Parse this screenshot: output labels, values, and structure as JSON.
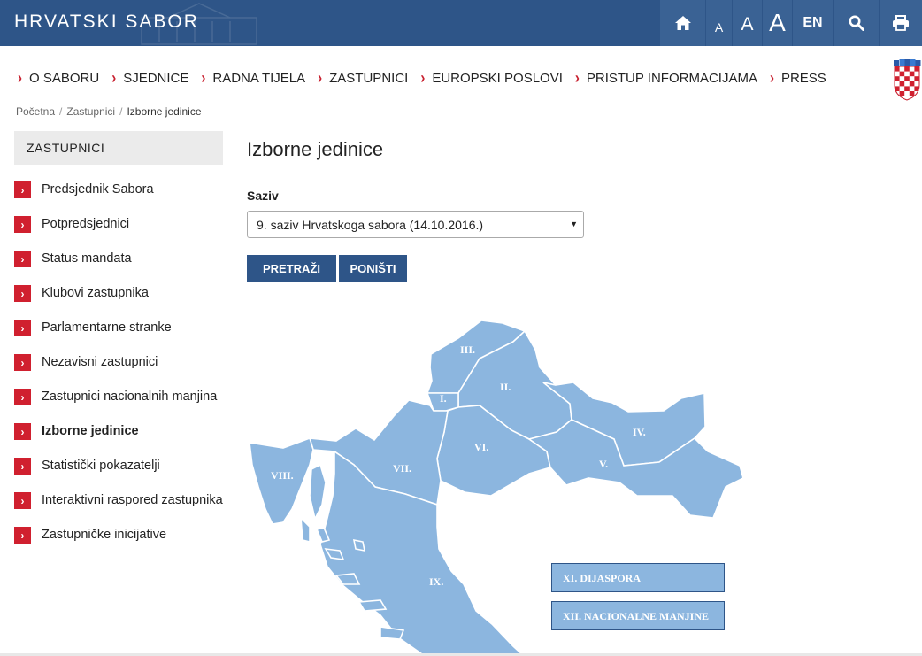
{
  "header": {
    "logo": "HRVATSKI SABOR",
    "font_small": "A",
    "font_medium": "A",
    "font_large": "A",
    "language": "EN"
  },
  "nav": [
    "O SABORU",
    "SJEDNICE",
    "RADNA TIJELA",
    "ZASTUPNICI",
    "EUROPSKI POSLOVI",
    "PRISTUP INFORMACIJAMA",
    "PRESS"
  ],
  "breadcrumb": [
    "Početna",
    "Zastupnici",
    "Izborne jedinice"
  ],
  "sidebar": {
    "title": "ZASTUPNICI",
    "items": [
      {
        "label": "Predsjednik Sabora"
      },
      {
        "label": "Potpredsjednici"
      },
      {
        "label": "Status mandata"
      },
      {
        "label": "Klubovi zastupnika"
      },
      {
        "label": "Parlamentarne stranke"
      },
      {
        "label": "Nezavisni zastupnici"
      },
      {
        "label": "Zastupnici nacionalnih manjina"
      },
      {
        "label": "Izborne jedinice",
        "active": true
      },
      {
        "label": "Statistički pokazatelji"
      },
      {
        "label": "Interaktivni raspored zastupnika"
      },
      {
        "label": "Zastupničke inicijative"
      }
    ]
  },
  "main": {
    "title": "Izborne jedinice",
    "field_label": "Saziv",
    "select_value": "9. saziv Hrvatskoga sabora (14.10.2016.)",
    "search_button": "PRETRAŽI",
    "reset_button": "PONIŠTI"
  },
  "map": {
    "regions": [
      "I.",
      "II.",
      "III.",
      "IV.",
      "V.",
      "VI.",
      "VII.",
      "VIII.",
      "IX."
    ],
    "extra": [
      "XI. DIJASPORA",
      "XII. NACIONALNE MANJINE"
    ],
    "region_color": "#8cb6df"
  },
  "colors": {
    "header": "#2e5588",
    "accent": "#d0202f",
    "button": "#2e5588"
  }
}
